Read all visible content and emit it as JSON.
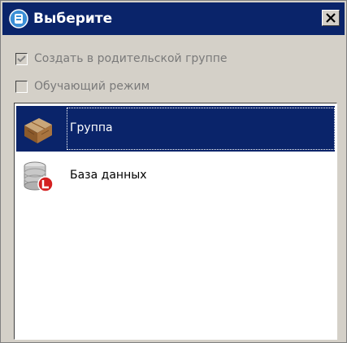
{
  "window": {
    "title": "Выберите",
    "close_label": "×"
  },
  "options": [
    {
      "label": "Создать в родительской группе",
      "checked": true,
      "enabled": false
    },
    {
      "label": "Обучающий режим",
      "checked": false,
      "enabled": false
    }
  ],
  "list": {
    "items": [
      {
        "label": "Группа",
        "icon": "box-icon",
        "selected": true
      },
      {
        "label": "База данных",
        "icon": "database-icon",
        "selected": false
      }
    ]
  },
  "colors": {
    "titlebar": "#0a246a",
    "selection": "#0a246a",
    "face": "#d4d0c8",
    "disabled_text": "#7a7a7a"
  }
}
